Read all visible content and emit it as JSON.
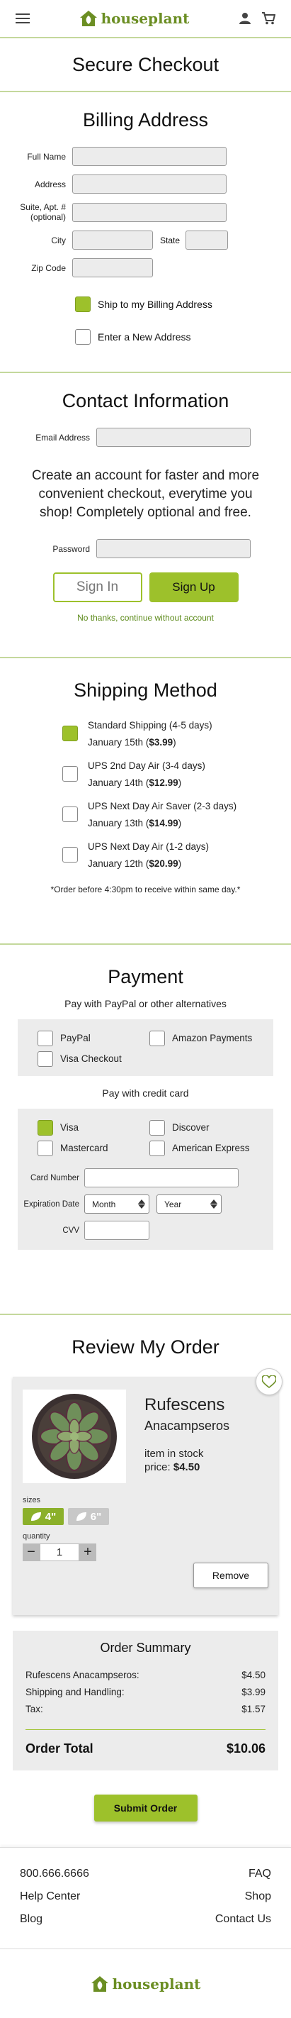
{
  "header": {
    "brand": "houseplant",
    "icons": [
      "menu-icon",
      "user-icon",
      "cart-icon"
    ],
    "accent": "#9dc12b"
  },
  "page_title": "Secure Checkout",
  "billing": {
    "title": "Billing Address",
    "labels": {
      "full_name": "Full Name",
      "address": "Address",
      "suite": "Suite, Apt. #\n(optional)",
      "suite_line1": "Suite, Apt. #",
      "suite_line2": "(optional)",
      "city": "City",
      "state": "State",
      "zip": "Zip Code"
    },
    "options": [
      {
        "label": "Ship to my Billing Address",
        "checked": true
      },
      {
        "label": "Enter a New Address",
        "checked": false
      }
    ]
  },
  "contact": {
    "title": "Contact Information",
    "email_label": "Email Address",
    "blurb": "Create an account for faster and more convenient checkout, everytime you shop! Completely optional and free.",
    "password_label": "Password",
    "sign_in": "Sign In",
    "sign_up": "Sign Up",
    "skip_link": "No thanks, continue without account"
  },
  "shipping": {
    "title": "Shipping Method",
    "methods": [
      {
        "name": "Standard Shipping (4-5 days)",
        "date": "January 15th",
        "price": "$3.99",
        "checked": true
      },
      {
        "name": "UPS 2nd Day Air (3-4 days)",
        "date": "January 14th",
        "price": "$12.99",
        "checked": false
      },
      {
        "name": "UPS Next Day Air Saver (2-3 days)",
        "date": "January 13th",
        "price": "$14.99",
        "checked": false
      },
      {
        "name": "UPS Next Day Air (1-2 days)",
        "date": "January 12th",
        "price": "$20.99",
        "checked": false
      }
    ],
    "note": "*Order before 4:30pm to receive within same day.*"
  },
  "payment": {
    "title": "Payment",
    "alt_label": "Pay with PayPal or other alternatives",
    "alt_options": {
      "paypal": "PayPal",
      "amazon": "Amazon Payments",
      "visa_checkout": "Visa Checkout"
    },
    "card_label": "Pay with credit card",
    "cards": {
      "visa": "Visa",
      "discover": "Discover",
      "mastercard": "Mastercard",
      "amex": "American Express"
    },
    "selected_card": "Visa",
    "card_number_label": "Card Number",
    "expiration_label": "Expiration Date",
    "month_placeholder": "Month",
    "year_placeholder": "Year",
    "cvv_label": "CVV"
  },
  "review": {
    "title": "Review My Order",
    "product": {
      "name": "Rufescens",
      "species": "Anacampseros",
      "stock": "item in stock",
      "price_label": "price:",
      "price": "$4.50",
      "sizes_label": "sizes",
      "sizes": [
        "4\"",
        "6\""
      ],
      "selected_size": "4\"",
      "quantity_label": "quantity",
      "quantity": "1",
      "minus": "−",
      "plus": "+",
      "remove": "Remove"
    }
  },
  "summary": {
    "title": "Order Summary",
    "rows": [
      {
        "label": "Rufescens Anacampseros:",
        "value": "$4.50"
      },
      {
        "label": "Shipping and Handling:",
        "value": "$3.99"
      },
      {
        "label": "Tax:",
        "value": "$1.57"
      }
    ],
    "total_label": "Order Total",
    "total": "$10.06",
    "submit": "Submit Order"
  },
  "footer": {
    "phone": "800.666.6666",
    "help": "Help Center",
    "blog": "Blog",
    "faq": "FAQ",
    "shop": "Shop",
    "contact": "Contact Us",
    "brand": "houseplant"
  }
}
